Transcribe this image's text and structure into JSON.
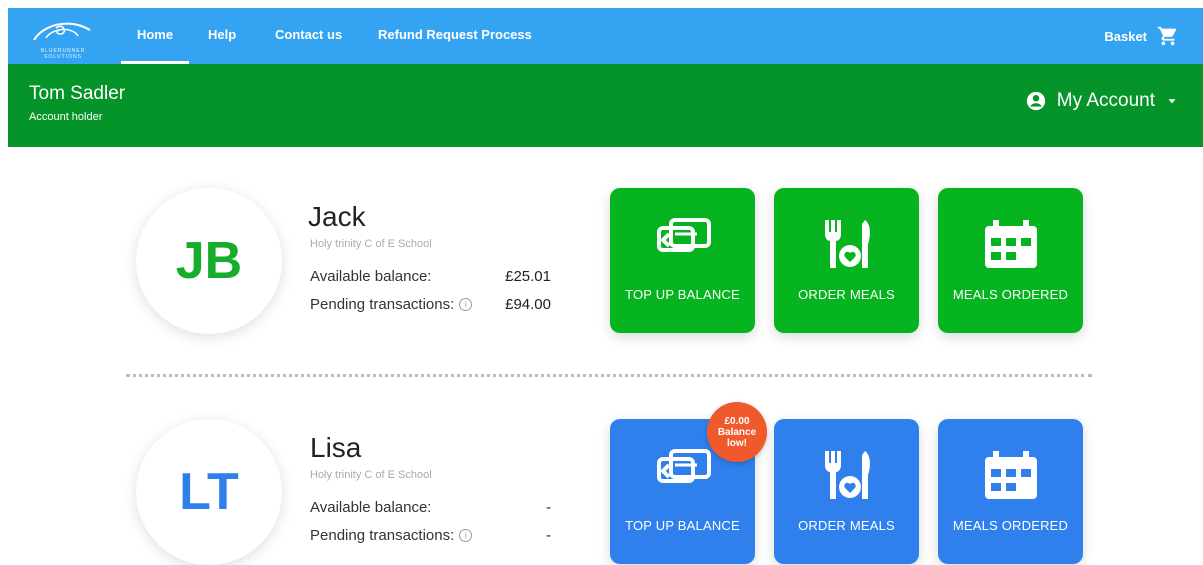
{
  "brand": {
    "logo_text": "BLUERUNNER SOLUTIONS"
  },
  "nav": {
    "items": [
      {
        "label": "Home"
      },
      {
        "label": "Help"
      },
      {
        "label": "Contact us"
      },
      {
        "label": "Refund Request Process"
      }
    ],
    "basket_label": "Basket"
  },
  "account": {
    "name": "Tom Sadler",
    "role": "Account holder",
    "menu_label": "My Account"
  },
  "labels": {
    "available_balance": "Available balance:",
    "pending_transactions": "Pending transactions:",
    "top_up": "TOP UP BALANCE",
    "order_meals": "ORDER MEALS",
    "meals_ordered": "MEALS ORDERED"
  },
  "children": [
    {
      "initials": "JB",
      "name": "Jack",
      "school": "Holy trinity C of E School",
      "balance": "£25.01",
      "pending": "£94.00"
    },
    {
      "initials": "LT",
      "name": "Lisa",
      "school": "Holy trinity C of E School",
      "balance": "-",
      "pending": "-"
    }
  ],
  "low_balance_badge": {
    "amount": "£0.00",
    "line1": "Balance",
    "line2": "low!"
  },
  "colors": {
    "nav_blue": "#34a4f2",
    "account_green": "#05942a",
    "tile_green": "#05b41e",
    "tile_blue": "#2f80ed",
    "badge_orange": "#f0592c"
  }
}
